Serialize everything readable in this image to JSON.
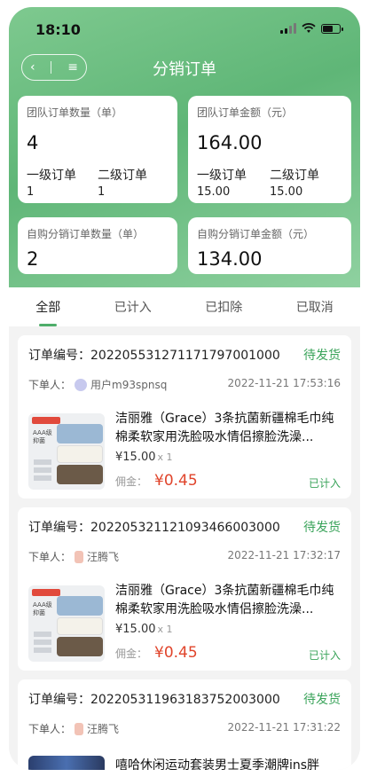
{
  "status_bar": {
    "time": "18:10"
  },
  "nav": {
    "back_icon": "back-icon",
    "menu_icon": "menu-icon",
    "title": "分销订单"
  },
  "stats": {
    "team_count": {
      "label": "团队订单数量（单）",
      "value": "4",
      "level1_label": "一级订单",
      "level1_value": "1",
      "level2_label": "二级订单",
      "level2_value": "1"
    },
    "team_amount": {
      "label": "团队订单金额（元）",
      "value": "164.00",
      "level1_label": "一级订单",
      "level1_value": "15.00",
      "level2_label": "二级订单",
      "level2_value": "15.00"
    },
    "self_count": {
      "label": "自购分销订单数量（单）",
      "value": "2"
    },
    "self_amount": {
      "label": "自购分销订单金额（元）",
      "value": "134.00"
    }
  },
  "tabs": [
    "全部",
    "已计入",
    "已扣除",
    "已取消"
  ],
  "orders": [
    {
      "order_label": "订单编号：",
      "order_no": "2022055312711717970010​00",
      "status": "待发货",
      "buyer_label": "下单人：",
      "buyer": "用户m93spnsq",
      "time": "2022-11-21 17:53:16",
      "title": "洁丽雅（Grace）3条抗菌新疆棉毛巾纯棉柔软家用洗脸吸水情侣擦脸洗澡...",
      "price": "¥15.00",
      "qty": "x 1",
      "commission_label": "佣金：",
      "commission": "¥0.45",
      "state": "已计入"
    },
    {
      "order_label": "订单编号：",
      "order_no": "2022053211210934660030​00",
      "status": "待发货",
      "buyer_label": "下单人：",
      "buyer": "汪腾飞",
      "time": "2022-11-21 17:32:17",
      "title": "洁丽雅（Grace）3条抗菌新疆棉毛巾纯棉柔软家用洗脸吸水情侣擦脸洗澡...",
      "price": "¥15.00",
      "qty": "x 1",
      "commission_label": "佣金：",
      "commission": "¥0.45",
      "state": "已计入"
    },
    {
      "order_label": "订单编号：",
      "order_no": "2022053119631837520030​00",
      "status": "待发货",
      "buyer_label": "下单人：",
      "buyer": "汪腾飞",
      "time": "2022-11-21 17:31:22",
      "title": "嘻哈休闲运动套装男士夏季潮牌ins胖"
    }
  ],
  "colors": {
    "accent": "#4fae6a",
    "commission": "#e0442b",
    "header_bg": "#6fbf83"
  }
}
